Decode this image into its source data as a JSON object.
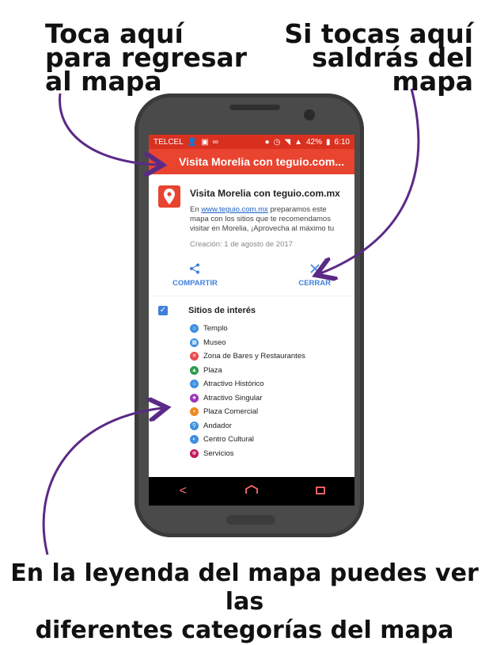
{
  "callouts": {
    "back": [
      "Toca aquí",
      "para regresar",
      "al mapa"
    ],
    "close": [
      "Si tocas aquí",
      "saldrás del",
      "mapa"
    ],
    "legend": [
      "En la leyenda del mapa puedes ver las",
      "diferentes categorías del mapa"
    ]
  },
  "status_bar": {
    "carrier": "TELCEL",
    "battery": "42%",
    "time": "6:10"
  },
  "app_bar": {
    "title": "Visita Morelia con teguio.com...",
    "back_icon": "arrow-left-icon"
  },
  "card": {
    "title": "Visita Morelia con teguio.com.mx",
    "desc_prefix": "En ",
    "desc_link": "www.teguio.com.mx",
    "desc_suffix": " preparamos este mapa con los sitios que te recomendamos visitar en Morelia, ¡Aprovecha al máximo tu",
    "date": "Creación: 1 de agosto de 2017",
    "icon": "map-pin-icon",
    "accent": "#e8442f"
  },
  "actions": {
    "share_label": "COMPARTIR",
    "close_label": "CERRAR",
    "color": "#3f7fdc"
  },
  "layer": {
    "label": "Sitios de interés",
    "checked": true
  },
  "legend": [
    {
      "label": "Templo",
      "color": "#3f8fe0",
      "icon": "church-icon"
    },
    {
      "label": "Museo",
      "color": "#3f8fe0",
      "icon": "museum-icon"
    },
    {
      "label": "Zona de Bares y Restaurantes",
      "color": "#e84c4c",
      "icon": "restaurant-icon"
    },
    {
      "label": "Plaza",
      "color": "#2e9b4f",
      "icon": "tree-icon"
    },
    {
      "label": "Atractivo Histórico",
      "color": "#3f8fe0",
      "icon": "monument-icon"
    },
    {
      "label": "Atractivo Singular",
      "color": "#9c33b8",
      "icon": "star-icon"
    },
    {
      "label": "Plaza Comercial",
      "color": "#f08a24",
      "icon": "shopping-icon"
    },
    {
      "label": "Andador",
      "color": "#3f8fe0",
      "icon": "walking-icon"
    },
    {
      "label": "Centro Cultural",
      "color": "#3f8fe0",
      "icon": "culture-icon"
    },
    {
      "label": "Servicios",
      "color": "#c2185b",
      "icon": "services-icon"
    }
  ],
  "colors": {
    "status_bar": "#d9301f",
    "app_bar": "#e8442f",
    "arrow": "#5b2a86",
    "nav_icons": "#ff6b6b"
  }
}
